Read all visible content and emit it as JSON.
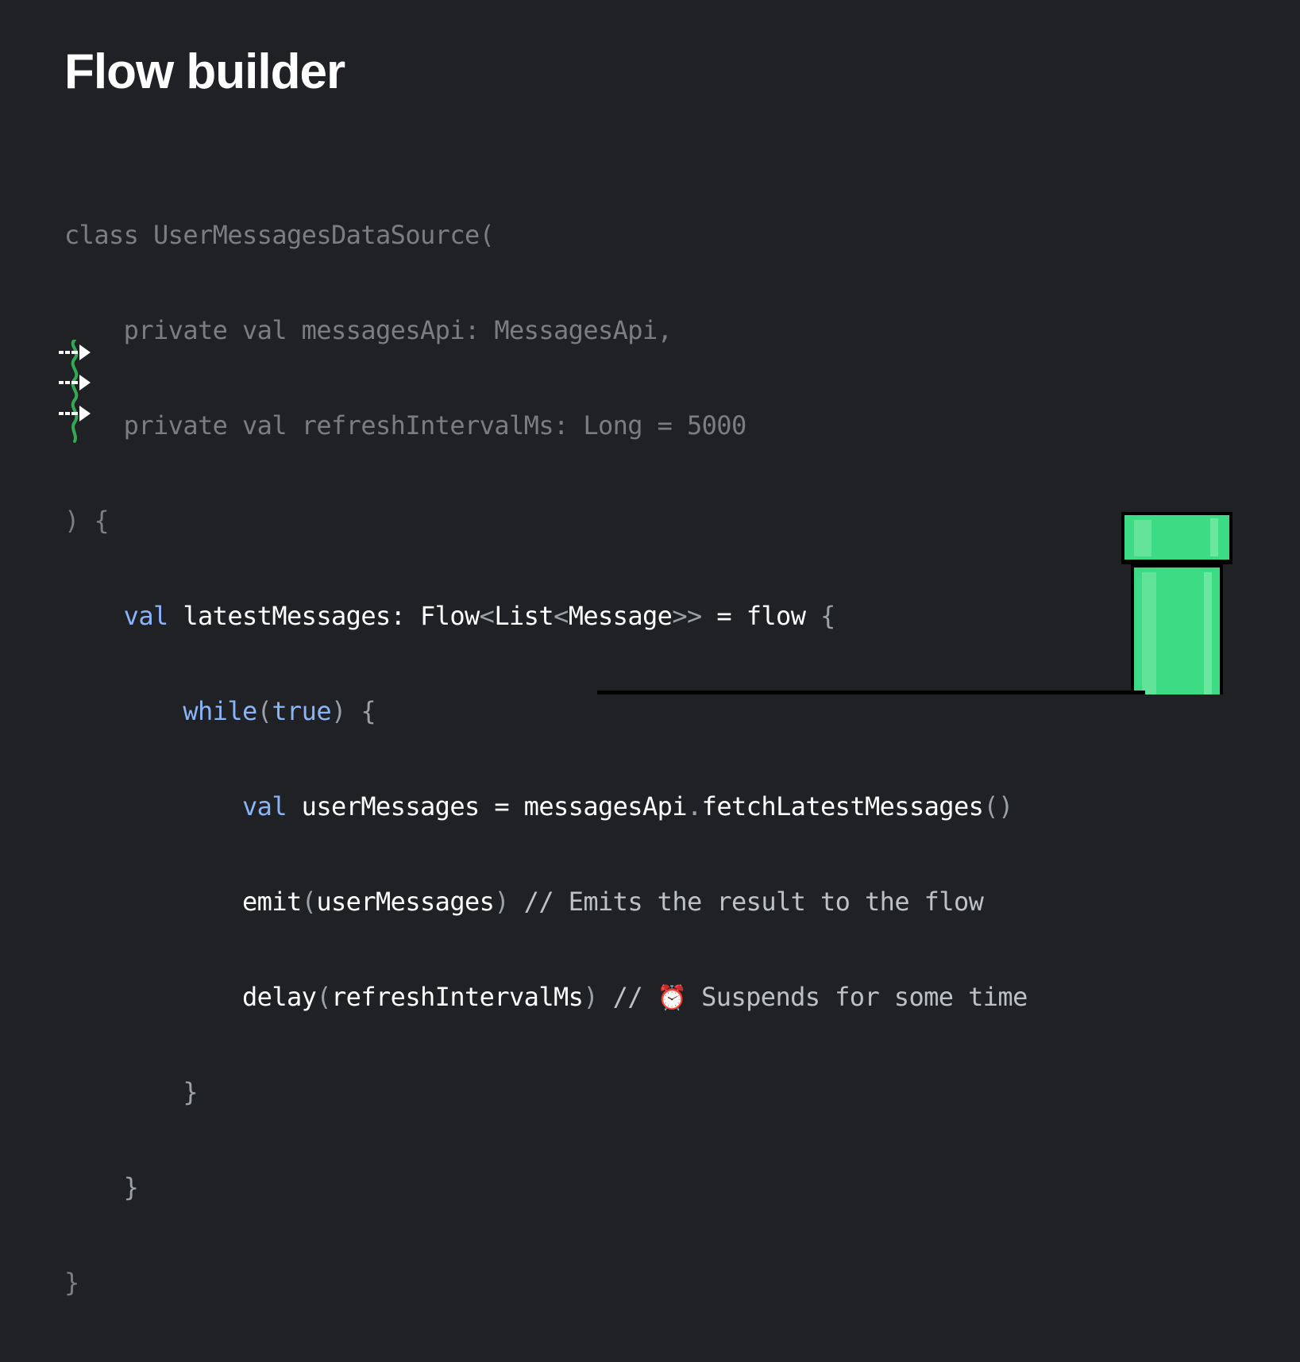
{
  "slide": {
    "title": "Flow builder"
  },
  "code": {
    "l1_kw": "class",
    "l1_rest": " UserMessagesDataSource(",
    "l2_a": "private val",
    "l2_b": " messagesApi: MessagesApi,",
    "l3_a": "private val",
    "l3_b": " refreshIntervalMs: Long = 5000",
    "l4": ") {",
    "l5_kw": "val",
    "l5_name": " latestMessages: ",
    "l5_type1": "Flow",
    "l5_lt1": "<",
    "l5_type2": "List",
    "l5_lt2": "<",
    "l5_type3": "Message",
    "l5_gt": ">>",
    "l5_eq": " = ",
    "l5_flow": "flow",
    "l5_brace": " {",
    "l6_kw": "while",
    "l6_p1": "(",
    "l6_true": "true",
    "l6_p2": ") {",
    "l7_kw": "val",
    "l7_a": " userMessages = messagesApi",
    "l7_dot": ".",
    "l7_b": "fetchLatestMessages",
    "l7_p": "()",
    "l8_a": "emit",
    "l8_p1": "(",
    "l8_b": "userMessages",
    "l8_p2": ")",
    "l8_comment": " // Emits the result to the flow",
    "l9_a": "delay",
    "l9_p1": "(",
    "l9_b": "refreshIntervalMs",
    "l9_p2": ")",
    "l9_comment_a": " // ",
    "l9_emoji": "⏰",
    "l9_comment_b": " Suspends for some time",
    "l10": "}",
    "l11": "}",
    "l12": "}"
  },
  "decor": {
    "marker_icon": "suspend-arrow-icon",
    "pipe_icon": "green-pipe-icon",
    "colors": {
      "background": "#202124",
      "keyword": "#8ab4f8",
      "pipe_green": "#3ddc84",
      "marker_green": "#34a853"
    }
  }
}
